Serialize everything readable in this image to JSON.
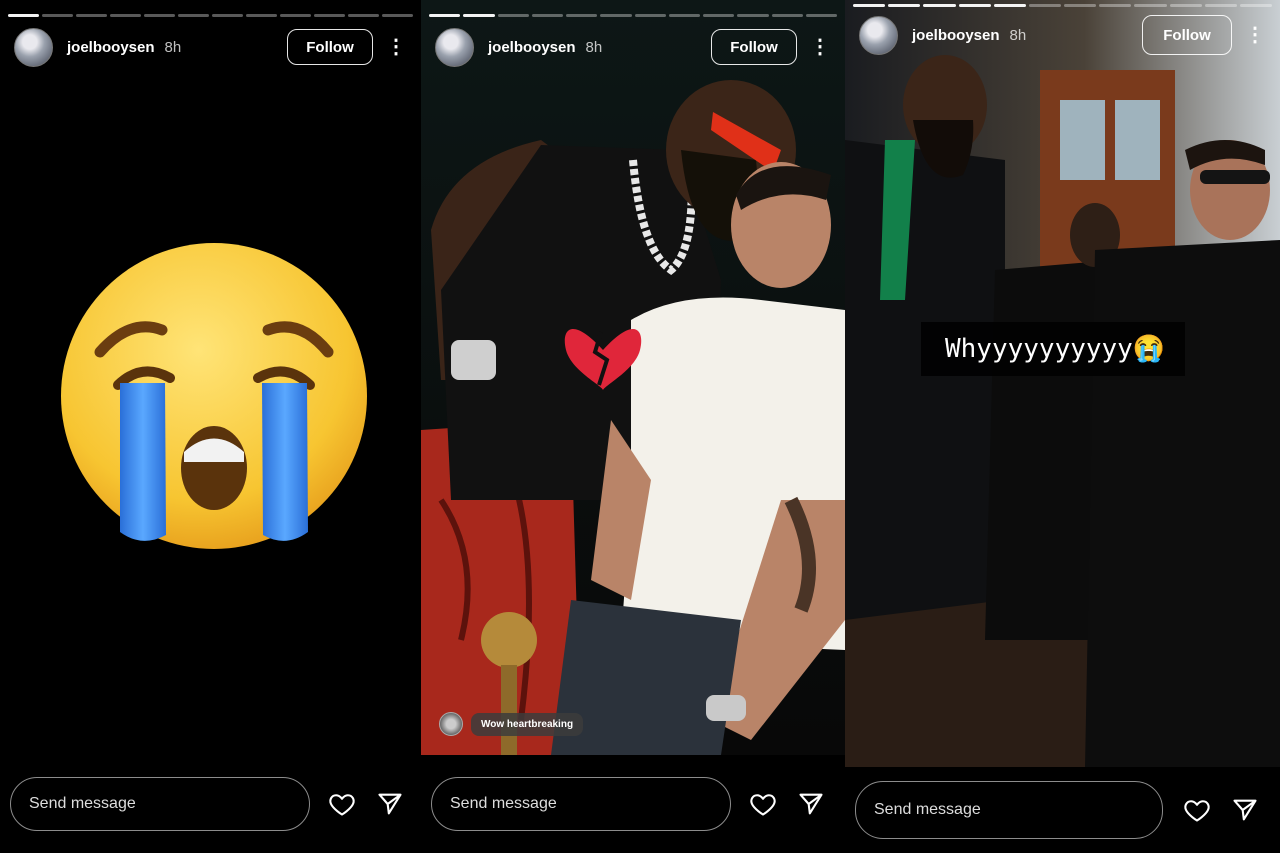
{
  "stories": [
    {
      "username": "joelbooysen",
      "time": "8h",
      "follow_label": "Follow",
      "more_icon": "⋮",
      "progress": {
        "total": 12,
        "done": 1
      },
      "message_placeholder": "Send message",
      "sticker_emoji": "loudly-crying-face",
      "icons": {
        "like": "heart-icon",
        "share": "send-icon"
      }
    },
    {
      "username": "joelbooysen",
      "time": "8h",
      "follow_label": "Follow",
      "more_icon": "⋮",
      "progress": {
        "total": 12,
        "done": 2
      },
      "message_placeholder": "Send message",
      "sticker_emoji": "broken-heart",
      "reply_text": "Wow heartbreaking",
      "icons": {
        "like": "heart-icon",
        "share": "send-icon"
      }
    },
    {
      "username": "joelbooysen",
      "time": "8h",
      "follow_label": "Follow",
      "more_icon": "⋮",
      "progress": {
        "total": 12,
        "done": 5
      },
      "message_placeholder": "Send message",
      "overlay_text": "Whyyyyyyyyyy😭",
      "icons": {
        "like": "heart-icon",
        "share": "send-icon"
      }
    }
  ],
  "colors": {
    "background": "#000000",
    "emoji_yellow": "#f7c531",
    "tears_blue": "#3e8bee",
    "broken_heart_red": "#e0263a"
  }
}
